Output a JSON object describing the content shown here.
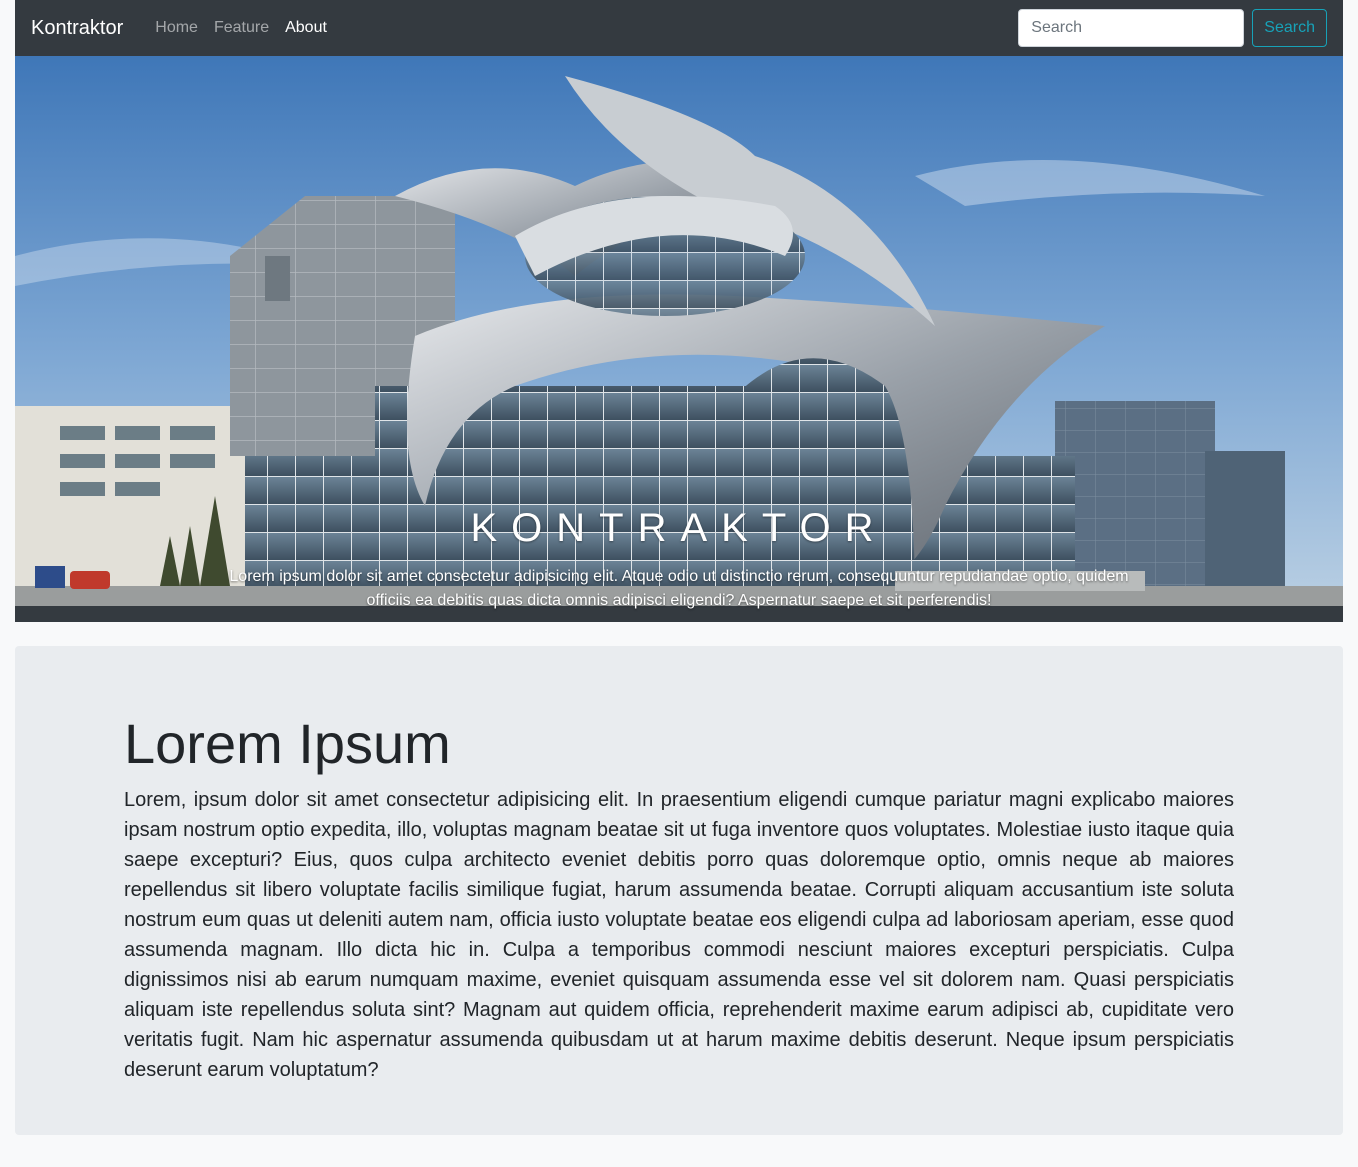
{
  "navbar": {
    "brand": "Kontraktor",
    "links": [
      "Home",
      "Feature",
      "About"
    ],
    "active_index": 2,
    "search_placeholder": "Search",
    "search_button": "Search"
  },
  "hero": {
    "title": "KONTRAKTOR",
    "text": "Lorem ipsum dolor sit amet consectetur adipisicing elit. Atque odio ut distinctio rerum, consequuntur repudiandae optio, quidem officiis ea debitis quas dicta omnis adipisci eligendi? Aspernatur saepe et sit perferendis!"
  },
  "jumbotron": {
    "heading": "Lorem Ipsum",
    "body": "Lorem, ipsum dolor sit amet consectetur adipisicing elit. In praesentium eligendi cumque pariatur magni explicabo maiores ipsam nostrum optio expedita, illo, voluptas magnam beatae sit ut fuga inventore quos voluptates. Molestiae iusto itaque quia saepe excepturi? Eius, quos culpa architecto eveniet debitis porro quas doloremque optio, omnis neque ab maiores repellendus sit libero voluptate facilis similique fugiat, harum assumenda beatae. Corrupti aliquam accusantium iste soluta nostrum eum quas ut deleniti autem nam, officia iusto voluptate beatae eos eligendi culpa ad laboriosam aperiam, esse quod assumenda magnam. Illo dicta hic in. Culpa a temporibus commodi nesciunt maiores excepturi perspiciatis. Culpa dignissimos nisi ab earum numquam maxime, eveniet quisquam assumenda esse vel sit dolorem nam. Quasi perspiciatis aliquam iste repellendus soluta sint? Magnam aut quidem officia, reprehenderit maxime earum adipisci ab, cupiditate vero veritatis fugit. Nam hic aspernatur assumenda quibusdam ut at harum maxime debitis deserunt. Neque ipsum perspiciatis deserunt earum voluptatum?"
  },
  "colors": {
    "navbar_bg": "#343a40",
    "search_button": "#17a2b8",
    "jumbotron_bg": "#e9ecef",
    "page_bg": "#f8f9fa"
  }
}
